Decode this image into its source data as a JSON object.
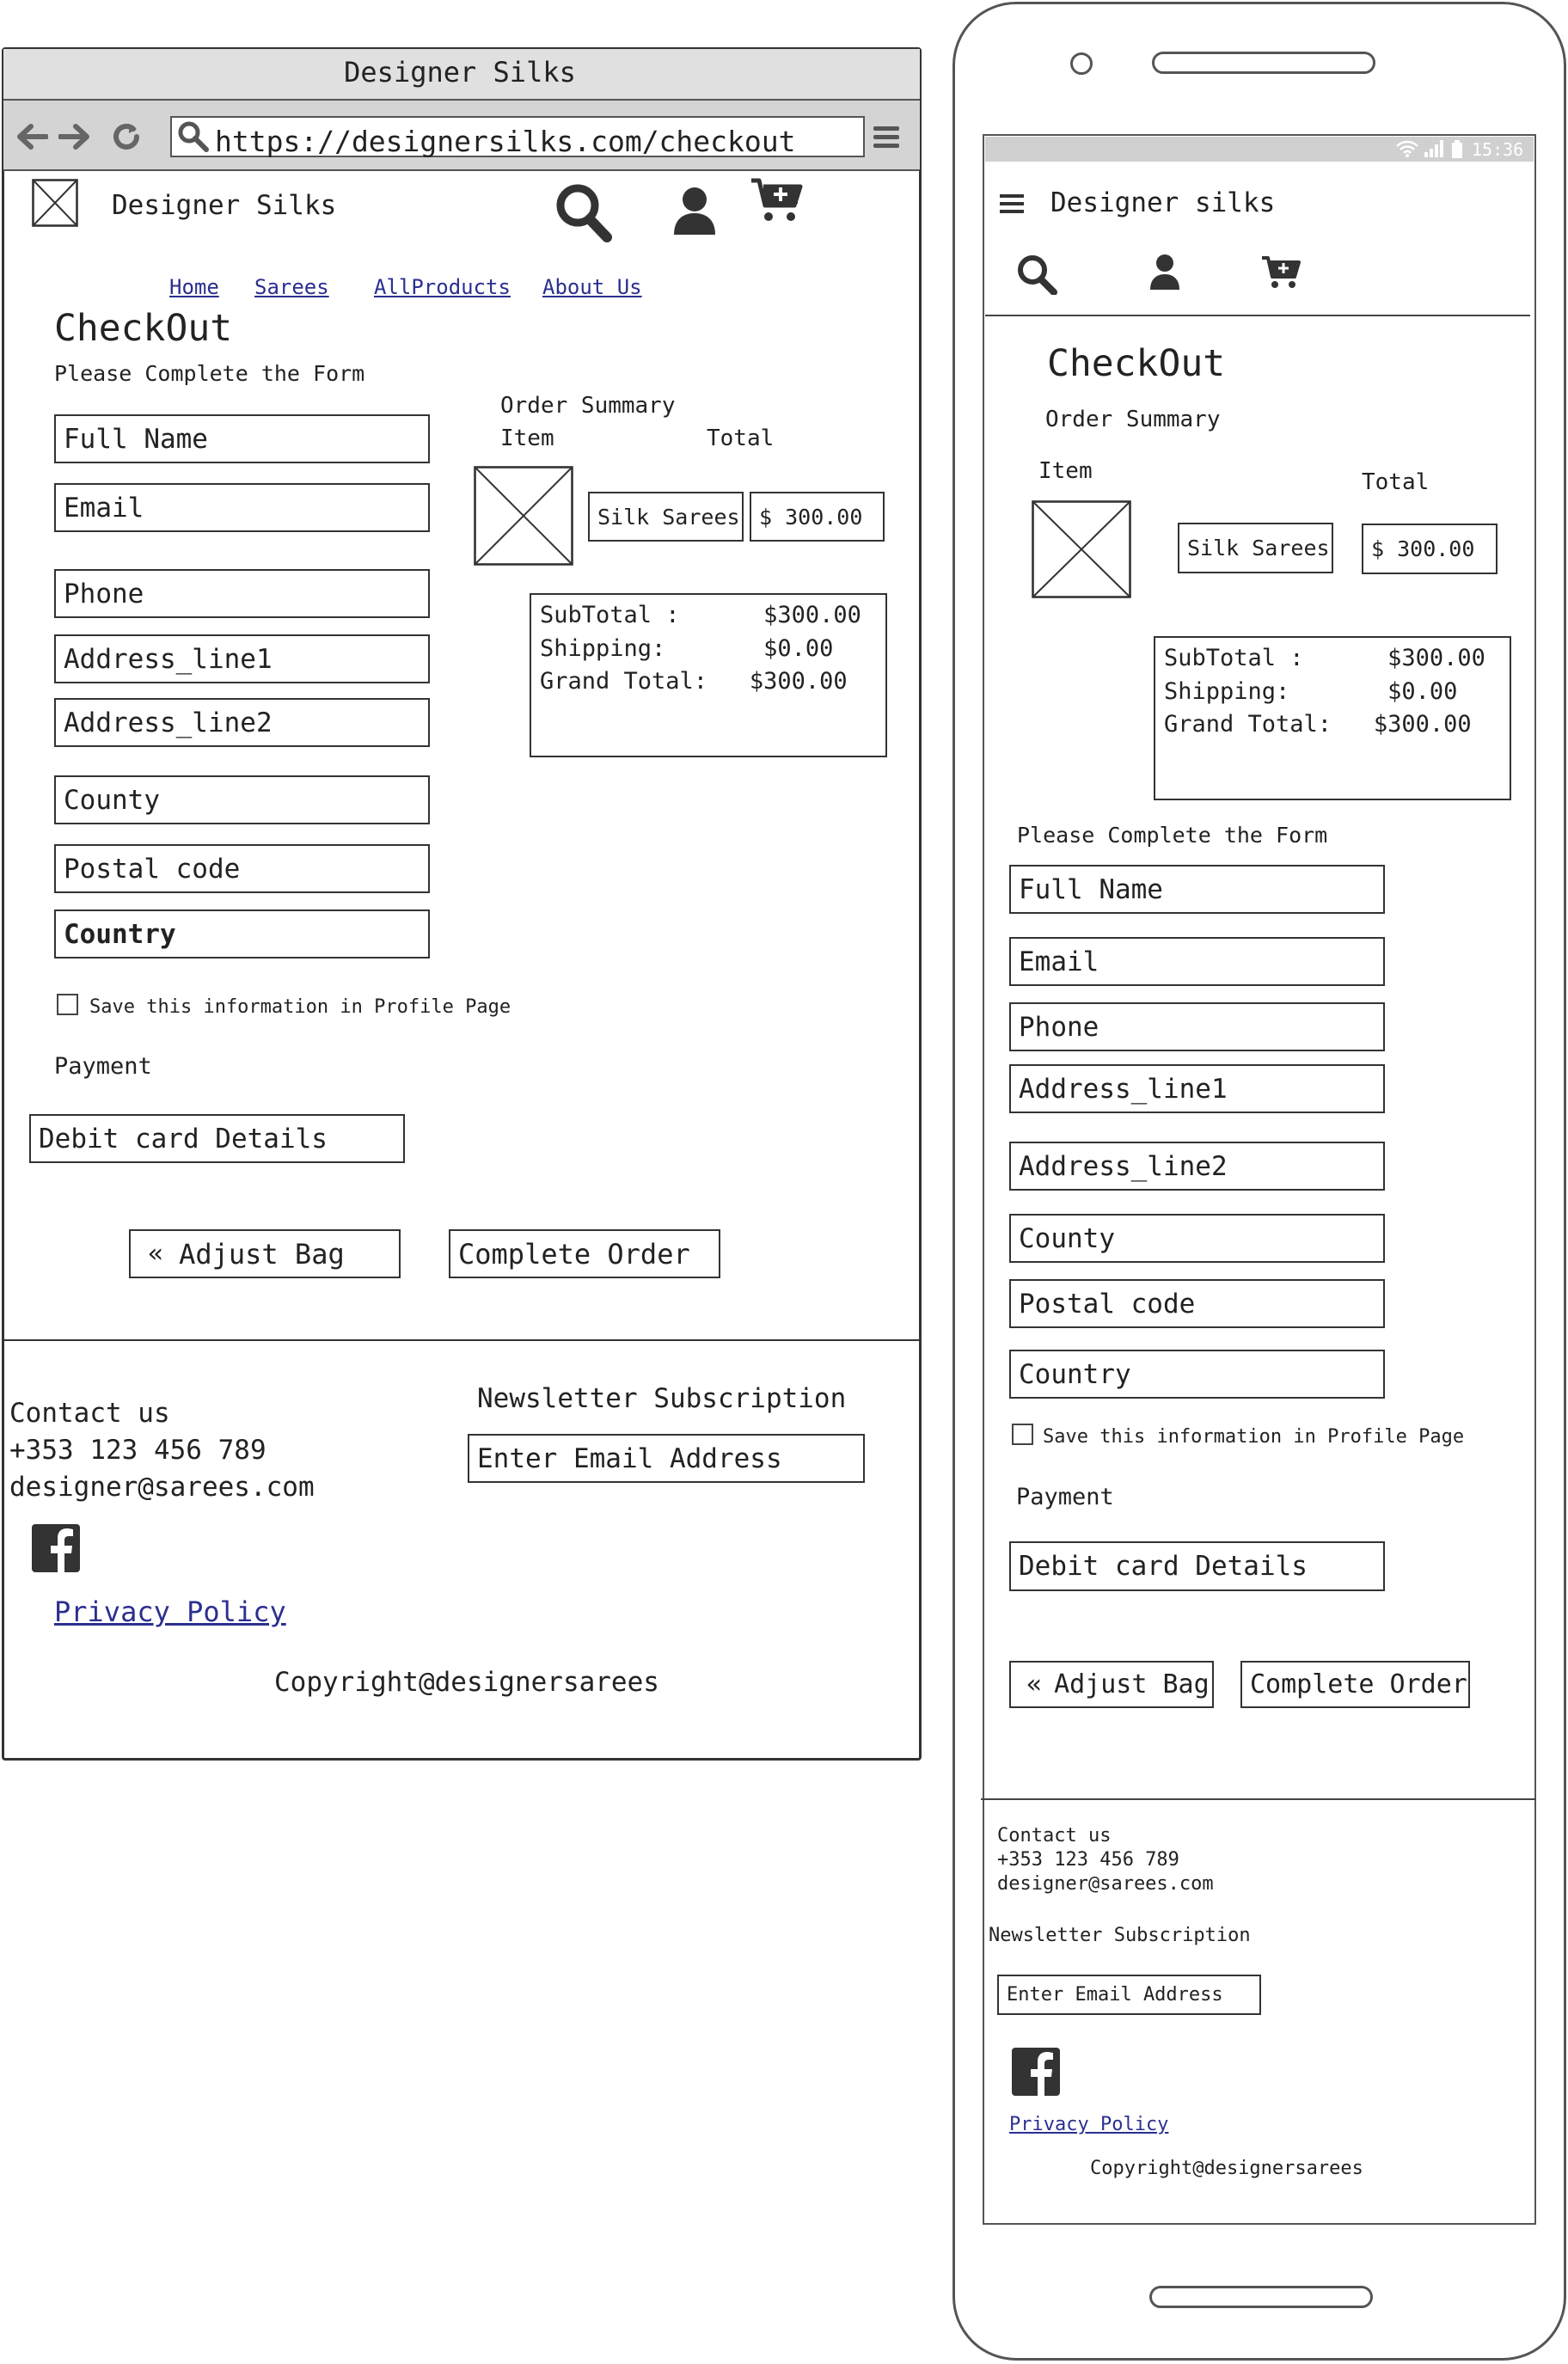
{
  "browser": {
    "title": "Designer Silks",
    "url": "https://designersilks.com/checkout"
  },
  "desktop": {
    "brand": "Designer Silks",
    "nav": [
      "Home",
      "Sarees",
      "AllProducts",
      "About Us"
    ],
    "heading": "CheckOut",
    "form_prompt": "Please Complete the Form",
    "fields": [
      "Full Name",
      "Email",
      "Phone",
      "Address_line1",
      "Address_line2",
      "County",
      "Postal code",
      "Country"
    ],
    "save_label": "Save this information in Profile Page",
    "payment_label": "Payment",
    "payment_field": "Debit card Details",
    "order_summary": "Order Summary",
    "item_header": "Item",
    "total_header": "Total",
    "item_name": "Silk Sarees",
    "item_price": "$ 300.00",
    "subtotal": "SubTotal :      $300.00",
    "shipping": "Shipping:       $0.00",
    "grand_total": "Grand Total:   $300.00",
    "adjust_bag": "Adjust Bag",
    "complete_order": "Complete Order",
    "footer": {
      "contact_title": "Contact us",
      "phone": "+353 123 456 789",
      "email": "designer@sarees.com",
      "newsletter_title": "Newsletter Subscription",
      "newsletter_placeholder": "Enter Email Address",
      "privacy": "Privacy Policy",
      "copyright": "Copyright@designersarees"
    }
  },
  "mobile": {
    "status_time": "15:36",
    "brand": "Designer silks",
    "heading": "CheckOut",
    "order_summary": "Order Summary",
    "item_header": "Item",
    "total_header": "Total",
    "item_name": "Silk Sarees",
    "item_price": "$ 300.00",
    "subtotal": "SubTotal :      $300.00",
    "shipping": "Shipping:       $0.00",
    "grand_total": "Grand Total:   $300.00",
    "form_prompt": "Please Complete the Form",
    "fields": [
      "Full Name",
      "Email",
      "Phone",
      "Address_line1",
      "Address_line2",
      "County",
      "Postal code",
      "Country"
    ],
    "save_label": "Save this information in Profile Page",
    "payment_label": "Payment",
    "payment_field": "Debit card Details",
    "adjust_bag": "Adjust Bag",
    "complete_order": "Complete Order",
    "footer": {
      "contact_title": "Contact us",
      "phone": "+353 123 456 789",
      "email": "designer@sarees.com",
      "newsletter_title": "Newsletter Subscription",
      "newsletter_placeholder": "Enter Email Address",
      "privacy": "Privacy Policy",
      "copyright": "Copyright@designersarees"
    }
  }
}
